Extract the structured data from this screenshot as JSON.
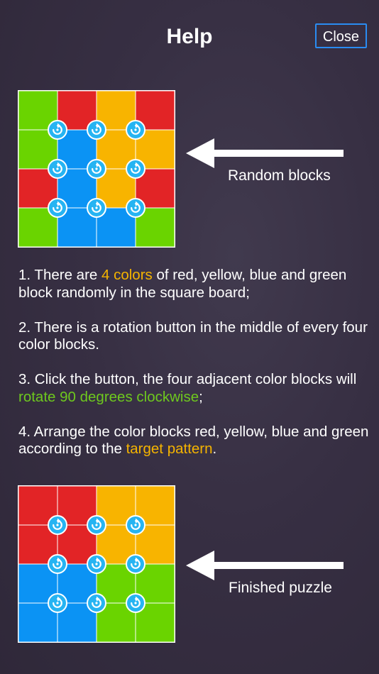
{
  "header": {
    "title": "Help",
    "close_label": "Close"
  },
  "colors": {
    "red": "#e22426",
    "yellow": "#f8b400",
    "blue": "#0b93f4",
    "green": "#6ad400",
    "button": "#26b4f2",
    "close_border": "#2a8cf2"
  },
  "boards": [
    {
      "caption": "Random blocks",
      "grid": [
        [
          "green",
          "red",
          "yellow",
          "red"
        ],
        [
          "green",
          "blue",
          "yellow",
          "yellow"
        ],
        [
          "red",
          "blue",
          "yellow",
          "red"
        ],
        [
          "green",
          "blue",
          "blue",
          "green"
        ]
      ]
    },
    {
      "caption": "Finished puzzle",
      "grid": [
        [
          "red",
          "red",
          "yellow",
          "yellow"
        ],
        [
          "red",
          "red",
          "yellow",
          "yellow"
        ],
        [
          "blue",
          "blue",
          "green",
          "green"
        ],
        [
          "blue",
          "blue",
          "green",
          "green"
        ]
      ]
    }
  ],
  "rotation_icon": "rotate-clockwise-icon",
  "arrow_icon": "arrow-left-icon",
  "instructions": [
    {
      "parts": [
        {
          "text": "1. There are ",
          "hl": ""
        },
        {
          "text": "4 colors",
          "hl": "yellow"
        },
        {
          "text": " of red, yellow, blue and green block randomly in the square board;",
          "hl": ""
        }
      ]
    },
    {
      "parts": [
        {
          "text": "2. There is a rotation button in the middle of every four color blocks.",
          "hl": ""
        }
      ]
    },
    {
      "parts": [
        {
          "text": "3. Click the button, the four adjacent color blocks will ",
          "hl": ""
        },
        {
          "text": "rotate 90 degrees clockwise",
          "hl": "green"
        },
        {
          "text": ";",
          "hl": ""
        }
      ]
    },
    {
      "parts": [
        {
          "text": "4. Arrange the color blocks red, yellow, blue and green according to the ",
          "hl": ""
        },
        {
          "text": "target pattern",
          "hl": "yellow"
        },
        {
          "text": ".",
          "hl": ""
        }
      ]
    }
  ]
}
